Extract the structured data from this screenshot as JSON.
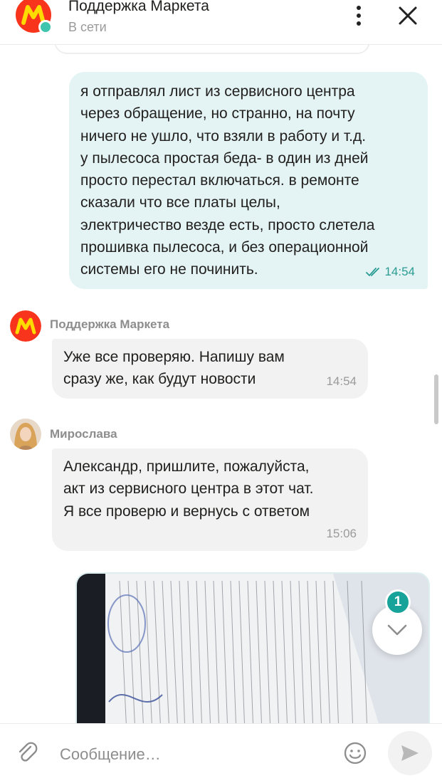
{
  "header": {
    "title": "Поддержка Маркета",
    "status": "В сети",
    "menu_icon": "more-vertical-icon",
    "close_icon": "close-icon"
  },
  "messages": [
    {
      "direction": "outgoing",
      "text": "я отправлял лист из сервисного центра\nчерез обращение, но странно, на почту\nничего не ушло, что взяли в работу и т.д.\nу пылесоса простая беда- в один из дней\nпросто перестал включаться. в ремонте\nсказали что все платы целы,\nэлектричество везде есть, просто слетела\nпрошивка пылесоса, и без операционной\nсистемы его не починить.",
      "time": "14:54",
      "status_icon": "double-check-icon"
    },
    {
      "direction": "incoming",
      "sender": "Поддержка Маркета",
      "text": "Уже все проверяю. Напишу вам\nсразу же, как будут новости",
      "time": "14:54"
    },
    {
      "direction": "incoming",
      "sender": "Мирослава",
      "text": "Александр, пришлите, пожалуйста,\nакт из сервисного центра в этот чат.\nЯ все проверю и вернусь с ответом",
      "time": "15:06"
    },
    {
      "direction": "outgoing",
      "type": "photo"
    }
  ],
  "scroll_down": {
    "unread_count": "1",
    "icon": "chevron-down-icon"
  },
  "composer": {
    "placeholder": "Сообщение…",
    "attach_icon": "paperclip-icon",
    "emoji_icon": "smile-icon",
    "send_icon": "send-icon"
  },
  "colors": {
    "brand_red": "#f8341c",
    "brand_yellow": "#ffdc00",
    "accent_teal": "#17a39a",
    "outgoing_bubble": "#e4f3f3",
    "incoming_bubble": "#f2f2f2"
  }
}
